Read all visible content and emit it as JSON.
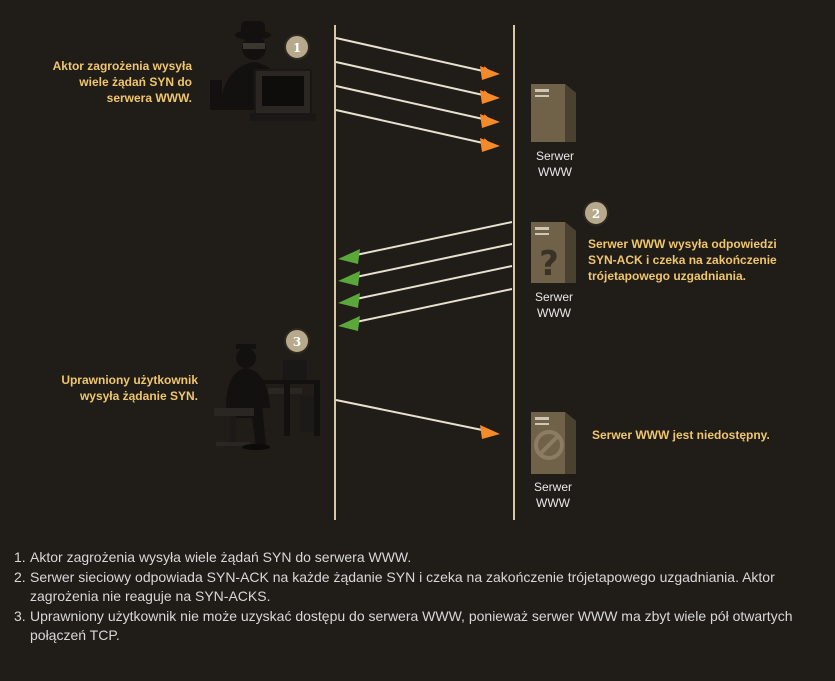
{
  "diagram": {
    "labels": {
      "attacker": [
        "Aktor zagrożenia wysyła",
        "wiele żądań SYN do",
        "serwera WWW."
      ],
      "server_response": [
        "Serwer WWW wysyła odpowiedzi",
        "SYN-ACK i czeka na zakończenie",
        "trójetapowego uzgadniania."
      ],
      "user": [
        "Uprawniony użytkownik",
        "wysyła żądanie SYN."
      ],
      "unavailable": "Serwer WWW jest niedostępny."
    },
    "server_caption": [
      "Serwer",
      "WWW"
    ],
    "badges": [
      "1",
      "2",
      "3"
    ],
    "colors": {
      "background": "#201c18",
      "label": "#f0c66c",
      "syn_arrow": "#f58a2a",
      "synack_arrow": "#5aa83a",
      "server": "#6f6249",
      "badge": "#b7a98c"
    }
  },
  "steps": [
    {
      "num": "1.",
      "text": "Aktor zagrożenia wysyła wiele żądań SYN do serwera WWW."
    },
    {
      "num": "2.",
      "text": "Serwer sieciowy odpowiada SYN-ACK na każde żądanie SYN i czeka na zakończenie trójetapowego uzgadniania. Aktor zagrożenia nie reaguje na SYN-ACKS."
    },
    {
      "num": "3.",
      "text": "Uprawniony użytkownik nie może uzyskać dostępu do serwera WWW, ponieważ serwer WWW ma zbyt wiele pół otwartych połączeń TCP."
    }
  ]
}
